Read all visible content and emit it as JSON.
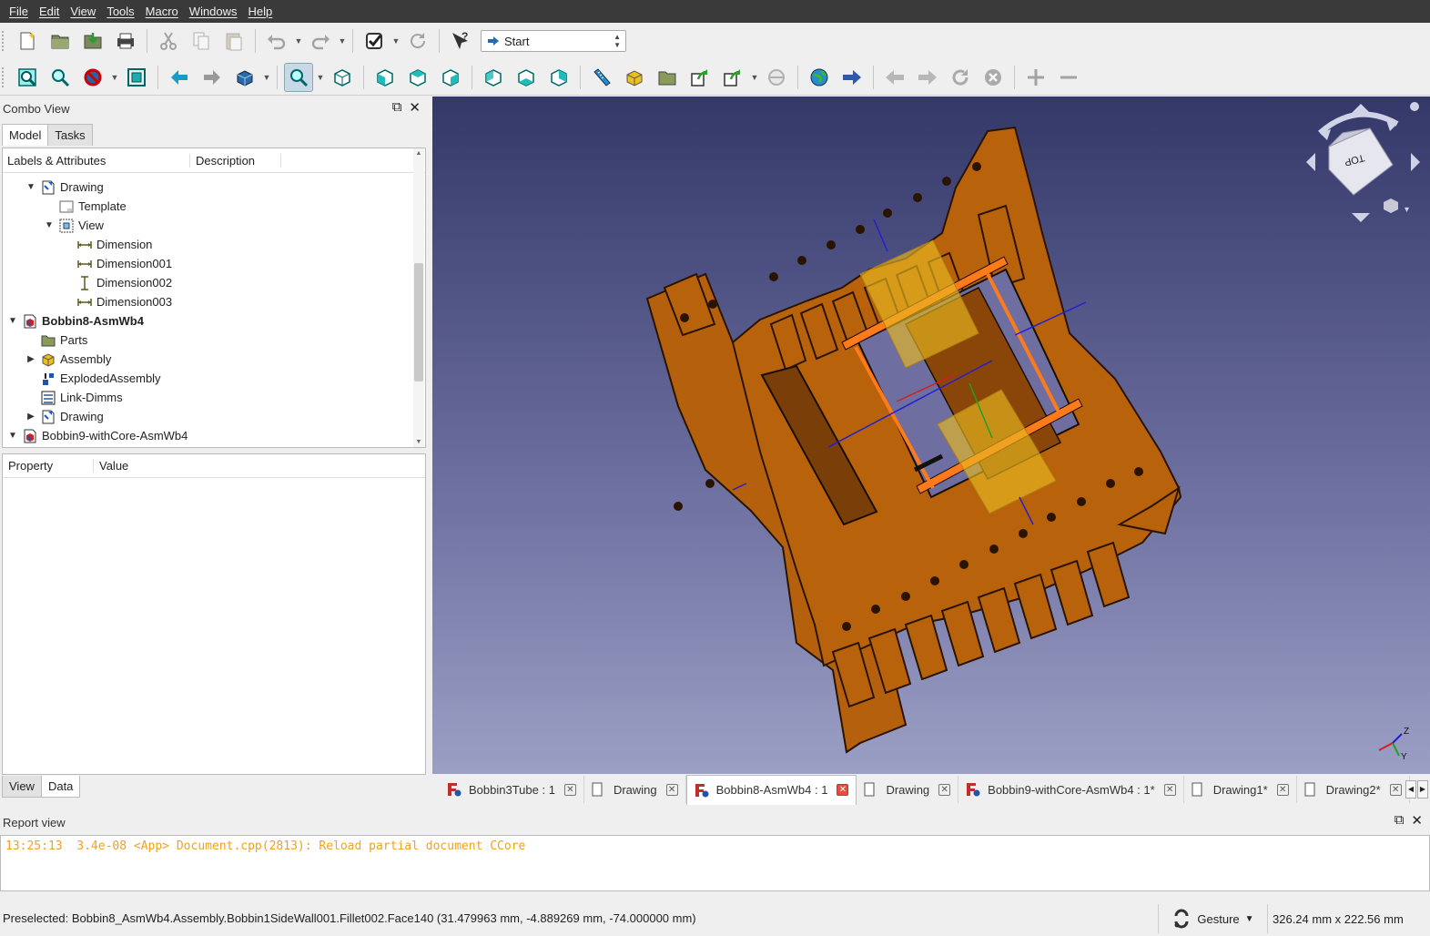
{
  "menu": [
    "File",
    "Edit",
    "View",
    "Tools",
    "Macro",
    "Windows",
    "Help"
  ],
  "workbench": {
    "selected": "Start"
  },
  "combo": {
    "title": "Combo View",
    "tabs": [
      "Model",
      "Tasks"
    ],
    "tree_headers": [
      "Labels & Attributes",
      "Description"
    ],
    "tree": [
      {
        "label": "Drawing",
        "icon": "drawing-page-icon"
      },
      {
        "label": "Template",
        "icon": "template-icon"
      },
      {
        "label": "View",
        "icon": "view-icon"
      },
      {
        "label": "Dimension",
        "icon": "dimension-horizontal-icon"
      },
      {
        "label": "Dimension001",
        "icon": "dimension-horizontal-icon"
      },
      {
        "label": "Dimension002",
        "icon": "dimension-vertical-icon"
      },
      {
        "label": "Dimension003",
        "icon": "dimension-horizontal-icon"
      },
      {
        "label": "Bobbin8-AsmWb4",
        "icon": "document-icon"
      },
      {
        "label": "Parts",
        "icon": "folder-icon"
      },
      {
        "label": "Assembly",
        "icon": "assembly-icon"
      },
      {
        "label": "ExplodedAssembly",
        "icon": "exploded-assembly-icon"
      },
      {
        "label": "Link-Dimms",
        "icon": "link-icon"
      },
      {
        "label": "Drawing",
        "icon": "drawing-page-icon"
      },
      {
        "label": "Bobbin9-withCore-AsmWb4",
        "icon": "document-icon"
      }
    ],
    "prop_headers": [
      "Property",
      "Value"
    ],
    "prop_tabs": [
      "View",
      "Data"
    ]
  },
  "doc_tabs": [
    {
      "label": "Bobbin3Tube : 1",
      "icon": "freecad-doc-icon"
    },
    {
      "label": "Drawing",
      "icon": "page-icon"
    },
    {
      "label": "Bobbin8-AsmWb4 : 1",
      "icon": "freecad-doc-icon"
    },
    {
      "label": "Drawing",
      "icon": "page-icon"
    },
    {
      "label": "Bobbin9-withCore-AsmWb4 : 1*",
      "icon": "freecad-doc-icon"
    },
    {
      "label": "Drawing1*",
      "icon": "page-icon"
    },
    {
      "label": "Drawing2*",
      "icon": "page-icon"
    }
  ],
  "navcube": {
    "face": "TOP"
  },
  "axis_labels": [
    "Z",
    "Y"
  ],
  "report": {
    "title": "Report view",
    "line": "13:25:13  3.4e-08 <App> Document.cpp(2813): Reload partial document CCore"
  },
  "status": {
    "message": "Preselected: Bobbin8_AsmWb4.Assembly.Bobbin1SideWall001.Fillet002.Face140 (31.479963 mm, -4.889269 mm, -74.000000 mm)",
    "nav_style": "Gesture",
    "dimensions": "326.24 mm x 222.56 mm"
  },
  "colors": {
    "part": "#b8620c",
    "coil": "#e8b820",
    "viewport_top": "#343869",
    "viewport_bottom": "#9c9fc4",
    "report_text": "#f0a21b"
  }
}
